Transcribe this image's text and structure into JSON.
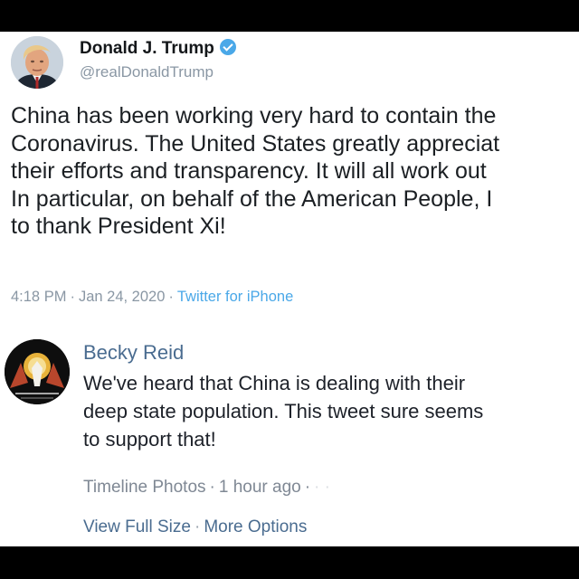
{
  "tweet": {
    "author_name": "Donald J. Trump",
    "handle": "@realDonaldTrump",
    "verified_icon": "verified-badge-icon",
    "text_lines": [
      "China has been working very hard to contain the",
      "Coronavirus. The United States greatly appreciat",
      "their efforts and transparency. It will all work out",
      "In particular, on behalf of the American People, I",
      "to thank President Xi!"
    ],
    "time": "4:18 PM",
    "date": "Jan 24, 2020",
    "source": "Twitter for iPhone",
    "separator": "·",
    "colors": {
      "link": "#4aa8e8",
      "meta": "#8a97a4",
      "text": "#1b1f23"
    }
  },
  "comment": {
    "author_name": "Becky Reid",
    "text_lines": [
      "We've heard that China is dealing with their",
      "deep state population. This tweet sure seems",
      "to support that!"
    ],
    "album": "Timeline Photos",
    "time_ago": "1 hour ago",
    "trailing_separator": "·",
    "obscured_tail": "·  ·",
    "action_view": "View Full Size",
    "action_more": "More Options",
    "separator": "·",
    "colors": {
      "name": "#4a6c90",
      "meta": "#7f8894"
    }
  }
}
